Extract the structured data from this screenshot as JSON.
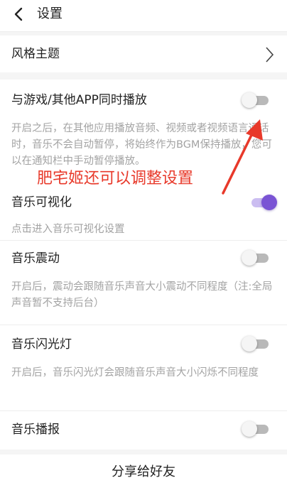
{
  "header": {
    "title": "设置"
  },
  "theme": {
    "label": "风格主题"
  },
  "settings": [
    {
      "label": "与游戏/其他APP同时播放",
      "on": false,
      "desc": "开启之后，在其他应用播放音频、视频或者视频语言通话时，音乐不会自动暂停，将始终作为BGM保持播放，您可以在通知栏中手动暂停播放。"
    },
    {
      "label": "音乐可视化",
      "on": true,
      "desc": "点击进入音乐可视化设置"
    },
    {
      "label": "音乐震动",
      "on": false,
      "desc": "开启后，震动会跟随音乐声音大小震动不同程度（注:全局声音暂不支持后台）"
    },
    {
      "label": "音乐闪光灯",
      "on": false,
      "desc": "开启后，音乐闪光灯会跟随音乐声音大小闪烁不同程度"
    },
    {
      "label": "音乐播报",
      "on": false
    }
  ],
  "annotation": {
    "text": "肥宅姬还可以调整设置",
    "color": "#e8392a"
  },
  "footer": {
    "share_label": "分享给好友"
  },
  "colors": {
    "accent": "#7a54d4",
    "desc_text": "#a3a3a3"
  },
  "icons": {
    "back": "chevron-left-icon",
    "theme_arrow": "chevron-right-icon"
  }
}
